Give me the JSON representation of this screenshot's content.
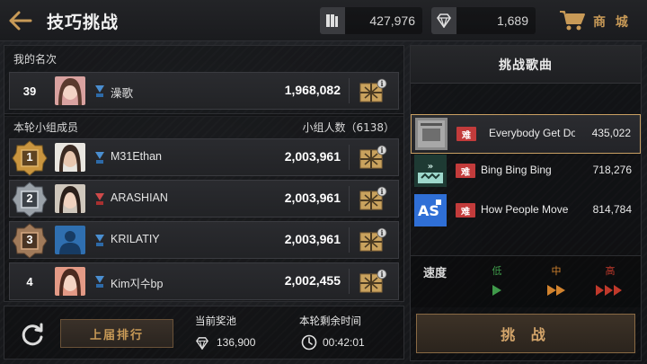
{
  "header": {
    "title": "技巧挑战",
    "currency": [
      {
        "icon": "tickets-icon",
        "value": "427,976"
      },
      {
        "icon": "diamond-icon",
        "value": "1,689"
      }
    ],
    "shop_label": "商 城"
  },
  "my_rank": {
    "section_label": "我的名次",
    "rank": "39",
    "name": "澡歌",
    "score": "1,968,082"
  },
  "group": {
    "section_label": "本轮小组成员",
    "count_label": "小组人数（6138）",
    "members": [
      {
        "rank": "1",
        "name": "M31Ethan",
        "score": "2,003,961"
      },
      {
        "rank": "2",
        "name": "ARASHIAN",
        "score": "2,003,961"
      },
      {
        "rank": "3",
        "name": "KRILATIY",
        "score": "2,003,961"
      },
      {
        "rank": "4",
        "name": "Kim지수bp",
        "score": "2,002,455"
      }
    ]
  },
  "footer": {
    "prev_rank_button": "上届排行",
    "prize_pool_label": "当前奖池",
    "prize_pool_value": "136,900",
    "time_left_label": "本轮剩余时间",
    "time_left_value": "00:42:01"
  },
  "songs": {
    "title": "挑战歌曲",
    "items": [
      {
        "difficulty": "难",
        "title": "Everybody Get Dov",
        "score": "435,022",
        "selected": true
      },
      {
        "difficulty": "难",
        "title": "Bing Bing Bing",
        "score": "718,276",
        "selected": false
      },
      {
        "difficulty": "难",
        "title": "How People Move",
        "score": "814,784",
        "selected": false
      }
    ]
  },
  "speed": {
    "label": "速度",
    "options": [
      "低",
      "中",
      "高"
    ]
  },
  "challenge_button": "挑 战",
  "colors": {
    "accent_gold": "#c89a57",
    "difficulty_red": "#c23b3b",
    "speed_low": "#3f9a4a",
    "speed_mid": "#d2832e",
    "speed_high": "#c0392b"
  }
}
